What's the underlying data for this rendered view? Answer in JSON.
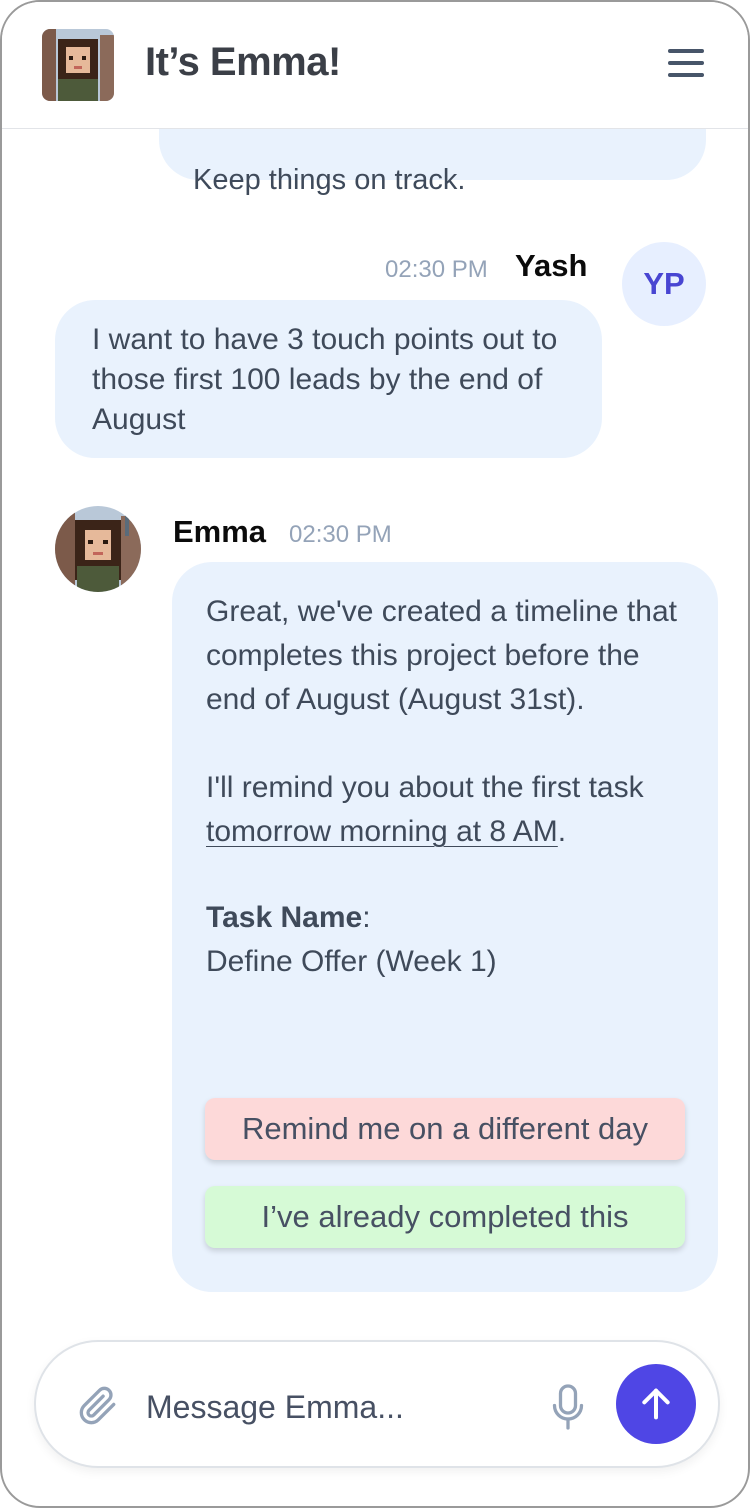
{
  "header": {
    "title": "It’s Emma!",
    "avatar_icon": "emma-avatar",
    "menu_icon": "hamburger-menu-icon"
  },
  "messages": {
    "previous": {
      "text": "Keep things on track."
    },
    "user": {
      "name": "Yash",
      "time": "02:30 PM",
      "initials": "YP",
      "text": "I want to have 3 touch points out to those first 100 leads by the end of August"
    },
    "assistant": {
      "name": "Emma",
      "time": "02:30 PM",
      "para1": "Great, we've created a timeline that completes this project before the end of August (August 31st).",
      "para2_prefix": "I'll remind you about the first task ",
      "para2_link": "tomorrow morning at 8 AM",
      "para2_suffix": ".",
      "task_label": "Task Name",
      "task_colon": ":",
      "task_value": "Define Offer (Week 1)",
      "action_remind": "Remind me on a different day",
      "action_completed": "I’ve already completed this"
    }
  },
  "composer": {
    "placeholder": "Message Emma...",
    "attach_icon": "paperclip-icon",
    "mic_icon": "microphone-icon",
    "send_icon": "arrow-up-icon"
  },
  "colors": {
    "accent": "#4f46e5",
    "bubble": "#e9f2fd",
    "remind_bg": "#fdd9d9",
    "completed_bg": "#d6fad6"
  }
}
